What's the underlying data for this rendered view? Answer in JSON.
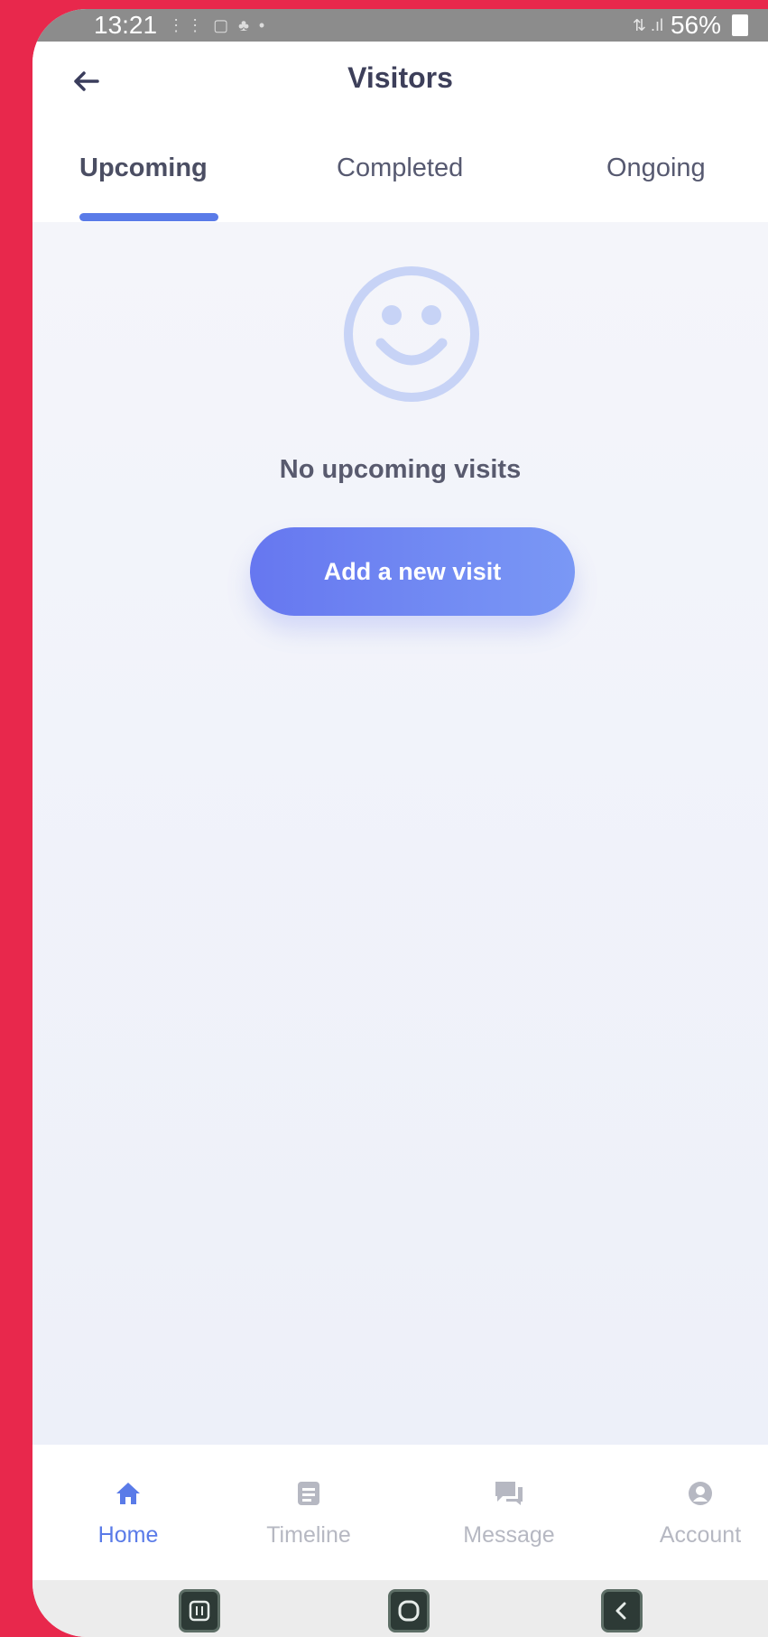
{
  "status_bar": {
    "time": "13:21",
    "battery": "56%"
  },
  "header": {
    "title": "Visitors"
  },
  "tabs": [
    {
      "label": "Upcoming",
      "active": true
    },
    {
      "label": "Completed",
      "active": false
    },
    {
      "label": "Ongoing",
      "active": false
    }
  ],
  "empty_state": {
    "icon": "smiley-icon",
    "message": "No upcoming visits",
    "button_label": "Add a new visit"
  },
  "bottom_nav": [
    {
      "label": "Home",
      "icon": "home-icon",
      "active": true
    },
    {
      "label": "Timeline",
      "icon": "timeline-icon",
      "active": false
    },
    {
      "label": "Message",
      "icon": "message-icon",
      "active": false
    },
    {
      "label": "Account",
      "icon": "account-icon",
      "active": false
    }
  ],
  "colors": {
    "accent": "#5a7be8",
    "frame": "#e8284c",
    "button_gradient_start": "#6677f0",
    "button_gradient_end": "#7a98f5"
  }
}
